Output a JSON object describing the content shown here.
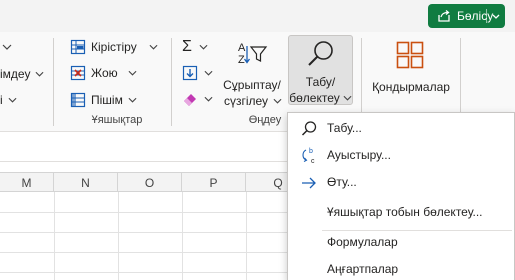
{
  "titlebar": {
    "share_label": "Бөлісу"
  },
  "ribbon": {
    "left_fragments": [
      "імдеу",
      "і"
    ],
    "cells_group": {
      "insert_label": "Кірістіру",
      "delete_label": "Жою",
      "format_label": "Пішім",
      "group_label": "Ұяшықтар"
    },
    "editing_group": {
      "sort_filter_label_1": "Сұрыптау/",
      "sort_filter_label_2": "сүзгілеу",
      "find_select_label_1": "Табу/",
      "find_select_label_2": "бөлектеу",
      "group_label": "Өңдеу"
    },
    "addins_label": "Қондырмалар"
  },
  "grid": {
    "columns": [
      "M",
      "N",
      "O",
      "P",
      "Q"
    ]
  },
  "find_menu": {
    "items": [
      {
        "label": "Табу...",
        "icon": "search-icon"
      },
      {
        "label": "Ауыстыру...",
        "icon": "replace-icon"
      },
      {
        "label": "Өту...",
        "icon": "arrow-right-icon"
      },
      {
        "label": "Ұяшықтар тобын бөлектеу...",
        "icon": ""
      },
      {
        "label": "Формулалар",
        "icon": ""
      },
      {
        "label": "Аңғартпалар",
        "icon": ""
      }
    ]
  },
  "colors": {
    "share_button": "#107c41",
    "accent": "#107c41"
  }
}
